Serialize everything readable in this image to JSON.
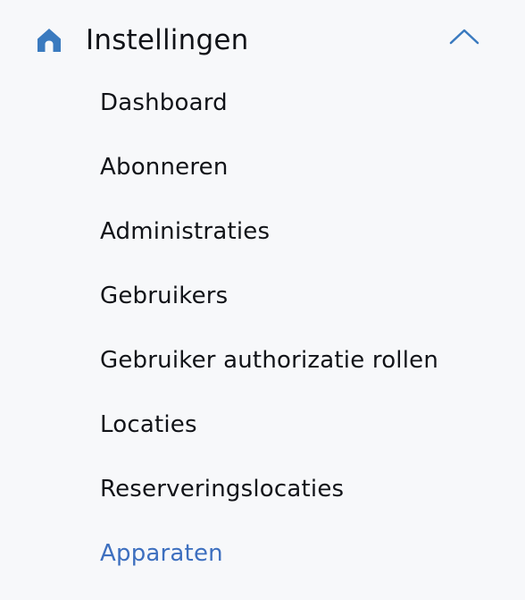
{
  "section": {
    "title": "Instellingen",
    "icon": "home-icon",
    "toggle_icon": "chevron-up-icon",
    "expanded": true,
    "icon_color": "#3a7abf",
    "active_color": "#3d6fbf"
  },
  "menu": {
    "items": [
      {
        "label": "Dashboard"
      },
      {
        "label": "Abonneren"
      },
      {
        "label": "Administraties"
      },
      {
        "label": "Gebruikers"
      },
      {
        "label": "Gebruiker authorizatie rollen"
      },
      {
        "label": "Locaties"
      },
      {
        "label": "Reserveringslocaties"
      },
      {
        "label": "Apparaten",
        "active": true
      }
    ]
  }
}
